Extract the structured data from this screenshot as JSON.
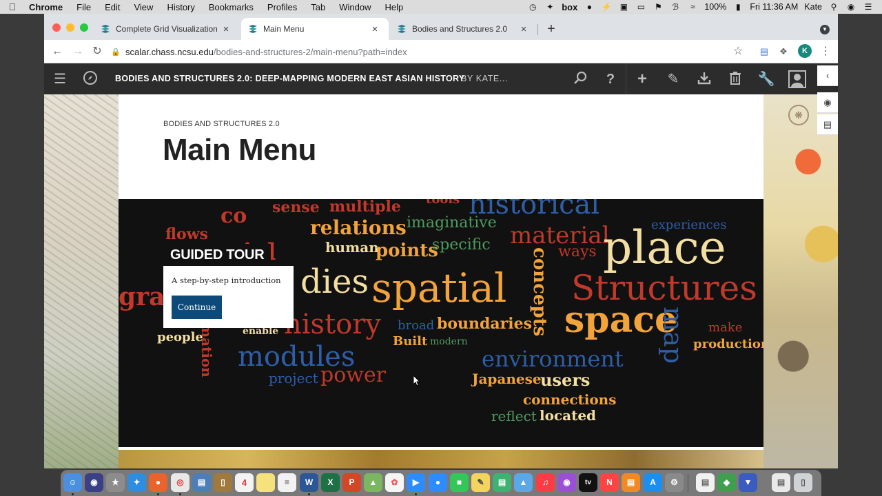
{
  "mac_menubar": {
    "app_name": "Chrome",
    "items": [
      "File",
      "Edit",
      "View",
      "History",
      "Bookmarks",
      "Profiles",
      "Tab",
      "Window",
      "Help"
    ],
    "battery": "100%",
    "clock": "Fri 11:36 AM",
    "user": "Kate",
    "box_label": "box"
  },
  "browser": {
    "tabs": [
      {
        "title": "Complete Grid Visualization",
        "active": false
      },
      {
        "title": "Main Menu",
        "active": true
      },
      {
        "title": "Bodies and Structures 2.0",
        "active": false
      }
    ],
    "url_host": "scalar.chass.ncsu.edu",
    "url_path": "/bodies-and-structures-2/main-menu?path=index",
    "profile_initial": "K"
  },
  "scalar": {
    "book_title": "BODIES AND STRUCTURES 2.0: DEEP-MAPPING MODERN EAST ASIAN HISTORY",
    "book_author": "BY KATE...",
    "kicker": "BODIES AND STRUCTURES 2.0",
    "page_title": "Main Menu",
    "tour_label": "GUIDED TOUR",
    "tour_description": "A step-by-step introduction",
    "tour_button": "Continue"
  },
  "word_cloud": [
    {
      "text": "sense",
      "color": "#c0392b"
    },
    {
      "text": "multiple",
      "color": "#c0392b"
    },
    {
      "text": "tools",
      "color": "#c0392b"
    },
    {
      "text": "historical",
      "color": "#2e5ea8"
    },
    {
      "text": "flows",
      "color": "#c0392b"
    },
    {
      "text": "co",
      "color": "#c0392b"
    },
    {
      "text": "relations",
      "color": "#f2a33a"
    },
    {
      "text": "imaginative",
      "color": "#4f9a5e"
    },
    {
      "text": "experiences",
      "color": "#2e5ea8"
    },
    {
      "text": "human",
      "color": "#f3dfa2"
    },
    {
      "text": "points",
      "color": "#f2a33a"
    },
    {
      "text": "specific",
      "color": "#4f9a5e"
    },
    {
      "text": "material",
      "color": "#c0392b"
    },
    {
      "text": "ways",
      "color": "#c0392b"
    },
    {
      "text": "place",
      "color": "#f3dfa2"
    },
    {
      "text": "cial",
      "color": "#c0392b"
    },
    {
      "text": "dies",
      "color": "#f3dfa2"
    },
    {
      "text": "spatial",
      "color": "#f2a33a"
    },
    {
      "text": "concepts",
      "color": "#f2a33a"
    },
    {
      "text": "Structures",
      "color": "#c0392b"
    },
    {
      "text": "gra",
      "color": "#c0392b"
    },
    {
      "text": "history",
      "color": "#c0392b"
    },
    {
      "text": "broad",
      "color": "#2e5ea8"
    },
    {
      "text": "boundaries",
      "color": "#f2a33a"
    },
    {
      "text": "space",
      "color": "#f2a33a"
    },
    {
      "text": "map",
      "color": "#2e5ea8"
    },
    {
      "text": "make",
      "color": "#c0392b"
    },
    {
      "text": "people",
      "color": "#f3dfa2"
    },
    {
      "text": "enable",
      "color": "#f3dfa2"
    },
    {
      "text": "Built",
      "color": "#f2a33a"
    },
    {
      "text": "modern",
      "color": "#4f9a5e"
    },
    {
      "text": "production",
      "color": "#f2a33a"
    },
    {
      "text": "modules",
      "color": "#2e5ea8"
    },
    {
      "text": "mation",
      "color": "#c0392b"
    },
    {
      "text": "environment",
      "color": "#2e5ea8"
    },
    {
      "text": "project",
      "color": "#2e5ea8"
    },
    {
      "text": "power",
      "color": "#c0392b"
    },
    {
      "text": "Japanese",
      "color": "#f2a33a"
    },
    {
      "text": "users",
      "color": "#f3dfa2"
    },
    {
      "text": "connections",
      "color": "#f2a33a"
    },
    {
      "text": "reflect",
      "color": "#4f9a5e"
    },
    {
      "text": "located",
      "color": "#f3dfa2"
    }
  ],
  "dock": {
    "calendar_day": "4",
    "badge": "1"
  }
}
